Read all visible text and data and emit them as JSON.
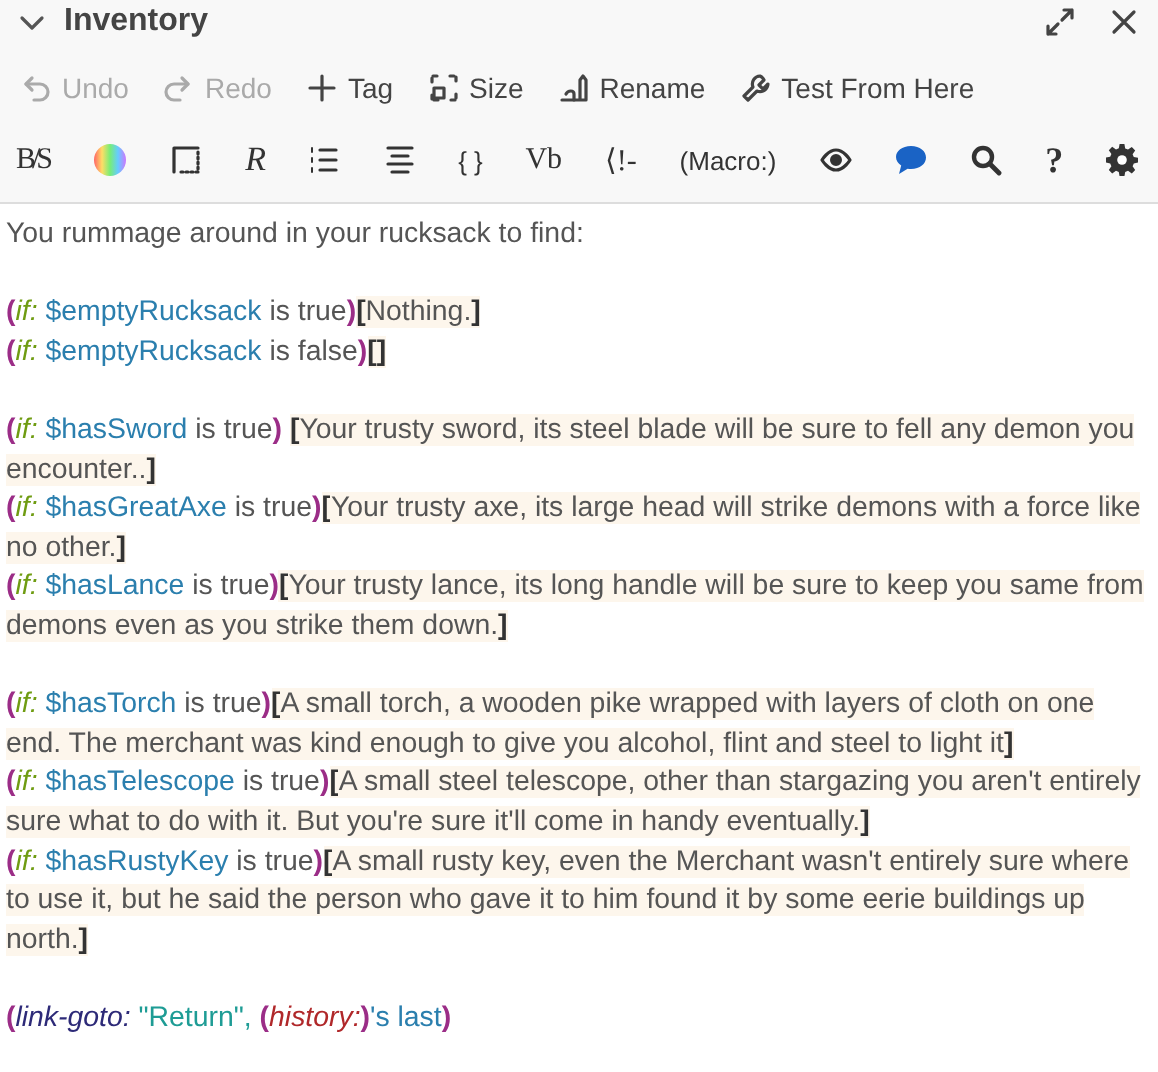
{
  "dialog": {
    "title": "Inventory",
    "expanded": true
  },
  "actions": [
    {
      "kind": "undo",
      "label": "Undo",
      "disabled": true
    },
    {
      "kind": "redo",
      "label": "Redo",
      "disabled": true
    },
    {
      "kind": "tag",
      "label": "Tag",
      "disabled": false
    },
    {
      "kind": "size",
      "label": "Size",
      "disabled": false
    },
    {
      "kind": "rename",
      "label": "Rename",
      "disabled": false
    },
    {
      "kind": "test",
      "label": "Test From Here",
      "disabled": false
    }
  ],
  "format_toolbar": [
    {
      "kind": "text",
      "label": "B/S"
    },
    {
      "kind": "colors"
    },
    {
      "kind": "border"
    },
    {
      "kind": "text",
      "label": "R"
    },
    {
      "kind": "list"
    },
    {
      "kind": "align"
    },
    {
      "kind": "text",
      "label": "{ }"
    },
    {
      "kind": "text",
      "label": "Vb"
    },
    {
      "kind": "text",
      "label": "⟨!-"
    },
    {
      "kind": "text",
      "label": "(Macro:)"
    },
    {
      "kind": "eye"
    },
    {
      "kind": "bubble"
    },
    {
      "kind": "search"
    },
    {
      "kind": "text",
      "label": "?"
    },
    {
      "kind": "gear"
    }
  ],
  "passage": [
    [
      [
        {
          "kind": "plain",
          "text": "You rummage around in your rucksack to find:"
        }
      ]
    ],
    [
      [
        {
          "kind": "paren",
          "text": "("
        },
        {
          "kind": "macro",
          "text": "if: "
        },
        {
          "kind": "variable",
          "text": "$emptyRucksack"
        },
        {
          "kind": "plain",
          "text": " is true"
        },
        {
          "kind": "paren",
          "text": ")"
        },
        {
          "kind": "bracket",
          "text": "["
        },
        {
          "kind": "hook",
          "text": "Nothing."
        },
        {
          "kind": "bracket",
          "text": "]"
        }
      ],
      [
        {
          "kind": "paren",
          "text": "("
        },
        {
          "kind": "macro",
          "text": "if: "
        },
        {
          "kind": "variable",
          "text": "$emptyRucksack"
        },
        {
          "kind": "plain",
          "text": " is false"
        },
        {
          "kind": "paren",
          "text": ")"
        },
        {
          "kind": "bracket",
          "text": "[]"
        }
      ]
    ],
    [
      [
        {
          "kind": "paren",
          "text": "("
        },
        {
          "kind": "macro",
          "text": "if: "
        },
        {
          "kind": "variable",
          "text": "$hasSword"
        },
        {
          "kind": "plain",
          "text": " is true"
        },
        {
          "kind": "paren",
          "text": ") "
        },
        {
          "kind": "bracket",
          "text": "["
        },
        {
          "kind": "hook",
          "text": "Your trusty sword, its steel blade will be sure to fell any demon you encounter.."
        },
        {
          "kind": "bracket",
          "text": "]"
        }
      ],
      [
        {
          "kind": "paren",
          "text": "("
        },
        {
          "kind": "macro",
          "text": "if: "
        },
        {
          "kind": "variable",
          "text": "$hasGreatAxe"
        },
        {
          "kind": "plain",
          "text": " is true"
        },
        {
          "kind": "paren",
          "text": ")"
        },
        {
          "kind": "bracket",
          "text": "["
        },
        {
          "kind": "hook",
          "text": "Your trusty axe, its large head will strike demons with a force like no other."
        },
        {
          "kind": "bracket",
          "text": "]"
        }
      ],
      [
        {
          "kind": "paren",
          "text": "("
        },
        {
          "kind": "macro",
          "text": "if: "
        },
        {
          "kind": "variable",
          "text": "$hasLance"
        },
        {
          "kind": "plain",
          "text": " is true"
        },
        {
          "kind": "paren",
          "text": ")"
        },
        {
          "kind": "bracket",
          "text": "["
        },
        {
          "kind": "hook",
          "text": "Your trusty lance, its long handle will be sure to keep you same from demons even as you strike them down."
        },
        {
          "kind": "bracket",
          "text": "]"
        }
      ]
    ],
    [
      [
        {
          "kind": "paren",
          "text": "("
        },
        {
          "kind": "macro",
          "text": "if: "
        },
        {
          "kind": "variable",
          "text": "$hasTorch"
        },
        {
          "kind": "plain",
          "text": " is true"
        },
        {
          "kind": "paren",
          "text": ")"
        },
        {
          "kind": "bracket",
          "text": "["
        },
        {
          "kind": "hook",
          "text": "A small torch, a wooden pike wrapped with layers of cloth on one end. The merchant was kind enough to give you alcohol, flint and steel to light it"
        },
        {
          "kind": "bracket",
          "text": "]"
        }
      ],
      [
        {
          "kind": "paren",
          "text": "("
        },
        {
          "kind": "macro",
          "text": "if: "
        },
        {
          "kind": "variable",
          "text": "$hasTelescope"
        },
        {
          "kind": "plain",
          "text": " is true"
        },
        {
          "kind": "paren",
          "text": ")"
        },
        {
          "kind": "bracket",
          "text": "["
        },
        {
          "kind": "hook",
          "text": "A small steel telescope, other than stargazing you aren't entirely sure what to do with it. But you're sure it'll come in handy eventually."
        },
        {
          "kind": "bracket",
          "text": "]"
        }
      ],
      [
        {
          "kind": "paren",
          "text": "("
        },
        {
          "kind": "macro",
          "text": "if: "
        },
        {
          "kind": "variable",
          "text": "$hasRustyKey"
        },
        {
          "kind": "plain",
          "text": " is true"
        },
        {
          "kind": "paren",
          "text": ")"
        },
        {
          "kind": "bracket",
          "text": "["
        },
        {
          "kind": "hook",
          "text": "A small rusty key, even the Merchant wasn't entirely sure where to use it, but he said the person who gave it to him found it by some eerie buildings up north."
        },
        {
          "kind": "bracket",
          "text": "]"
        }
      ]
    ],
    [
      [
        {
          "kind": "paren",
          "text": "("
        },
        {
          "kind": "link-macro",
          "text": "link-goto: "
        },
        {
          "kind": "string",
          "text": "\"Return\""
        },
        {
          "kind": "string",
          "text": ", "
        },
        {
          "kind": "paren",
          "text": "("
        },
        {
          "kind": "history",
          "text": "history:"
        },
        {
          "kind": "paren",
          "text": ")"
        },
        {
          "kind": "variable",
          "text": "'s last"
        },
        {
          "kind": "paren",
          "text": ")"
        }
      ]
    ]
  ]
}
